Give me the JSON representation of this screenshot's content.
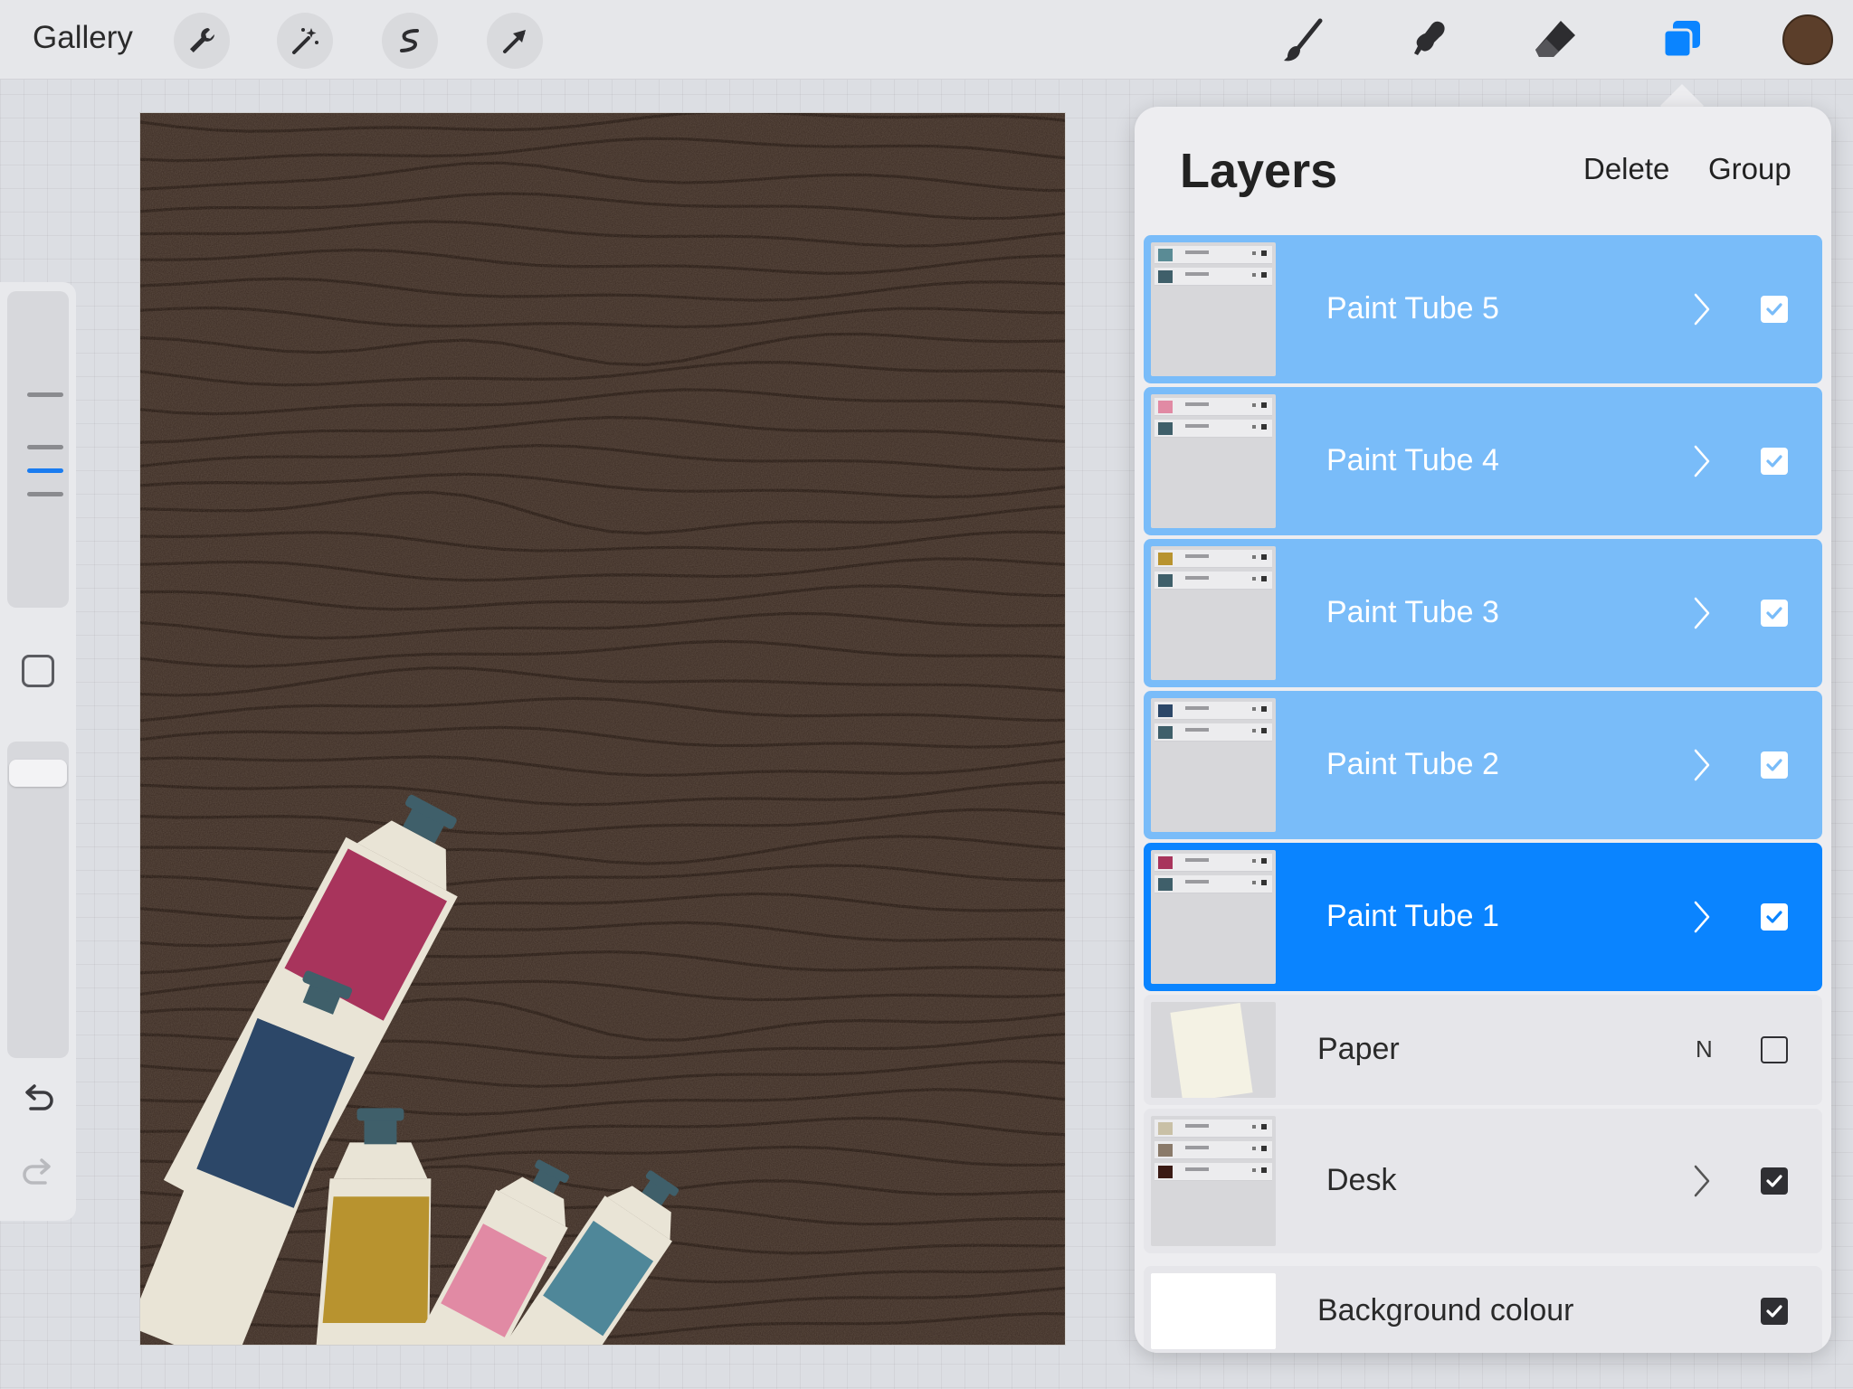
{
  "topbar": {
    "gallery_label": "Gallery",
    "tools_left": [
      "wrench-icon",
      "magic-wand-icon",
      "selection-icon",
      "transform-arrow-icon"
    ],
    "tools_right": [
      "brush-icon",
      "smudge-icon",
      "eraser-icon",
      "layers-icon"
    ],
    "active_tool": "layers-icon",
    "current_color": "#5b3e2a"
  },
  "sidebar": {
    "size_slider_level": 0.25,
    "opacity_slider_level": 0.95,
    "controls": [
      "modify-button",
      "undo-icon",
      "redo-icon"
    ]
  },
  "canvas": {
    "background_color": "#3a2a22",
    "grain_color": "#1e120c",
    "tube_colors": [
      "#a8345c",
      "#2c4768",
      "#b8932f",
      "#e18aa4",
      "#4f8799"
    ],
    "cap_color": "#3f5f6a",
    "tube_body_color": "#e9e4d6"
  },
  "layers_panel": {
    "title": "Layers",
    "delete_label": "Delete",
    "group_label": "Group",
    "accent_color": "#0a84ff",
    "group_highlight_color": "#79bcf9",
    "layers": [
      {
        "name": "Paint Tube 5",
        "state": "sub",
        "visible": true,
        "chevron": true,
        "thumb_swatches": [
          "#5a8b95",
          "#3f5f6a"
        ]
      },
      {
        "name": "Paint Tube 4",
        "state": "sub",
        "visible": true,
        "chevron": true,
        "thumb_swatches": [
          "#e18aa4",
          "#3f5f6a"
        ]
      },
      {
        "name": "Paint Tube 3",
        "state": "sub",
        "visible": true,
        "chevron": true,
        "thumb_swatches": [
          "#b8932f",
          "#3f5f6a"
        ]
      },
      {
        "name": "Paint Tube 2",
        "state": "sub",
        "visible": true,
        "chevron": true,
        "thumb_swatches": [
          "#2c4768",
          "#3f5f6a"
        ]
      },
      {
        "name": "Paint Tube 1",
        "state": "active",
        "visible": true,
        "chevron": true,
        "thumb_swatches": [
          "#a8345c",
          "#3f5f6a"
        ]
      },
      {
        "name": "Paper",
        "state": "plain",
        "visible": false,
        "chevron": false,
        "blend_mode": "N"
      },
      {
        "name": "Desk",
        "state": "plain",
        "visible": true,
        "chevron": true,
        "thumb_swatches": [
          "#c9c0a6",
          "#8a7a6a",
          "#3a1a14"
        ]
      },
      {
        "name": "Background colour",
        "state": "plain",
        "visible": true,
        "chevron": false
      }
    ]
  }
}
